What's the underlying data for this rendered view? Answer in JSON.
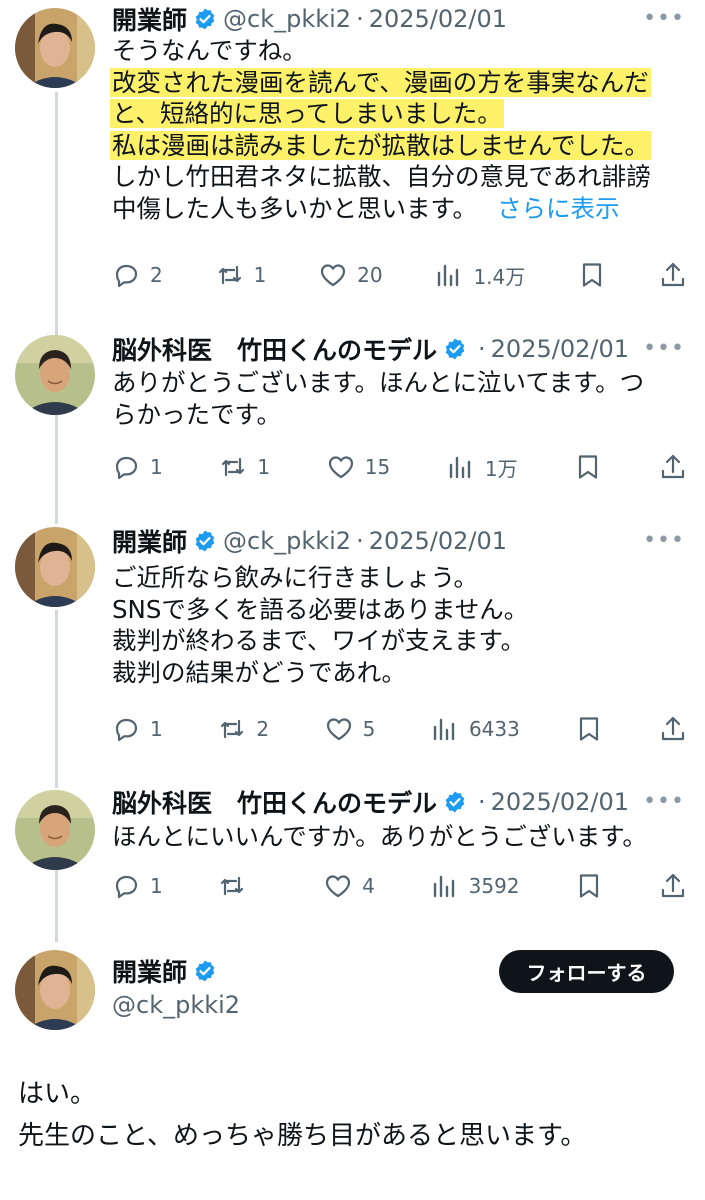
{
  "tweets": [
    {
      "name": "開業師",
      "handle": "@ck_pkki2",
      "date": "2025/02/01",
      "lines": [
        {
          "text": "そうなんですね。",
          "highlight": false
        },
        {
          "text": "改変された漫画を読んで、漫画の方を事実なんだ",
          "highlight": true
        },
        {
          "text": "と、短絡的に思ってしまいました。",
          "highlight": true
        },
        {
          "text": "私は漫画は読みましたが拡散はしませんでした。",
          "highlight": true
        },
        {
          "text": "しかし竹田君ネタに拡散、自分の意見であれ誹謗",
          "highlight": false
        },
        {
          "text": "中傷した人も多いかと思います。",
          "highlight": false
        }
      ],
      "show_more": "さらに表示",
      "replies": "2",
      "retweets": "1",
      "likes": "20",
      "views": "1.4万"
    },
    {
      "name": "脳外科医　竹田くんのモデル",
      "handle": "",
      "date": "2025/02/01",
      "lines": [
        {
          "text": "ありがとうございます。ほんとに泣いてます。つ",
          "highlight": false
        },
        {
          "text": "らかったです。",
          "highlight": false
        }
      ],
      "replies": "1",
      "retweets": "1",
      "likes": "15",
      "views": "1万"
    },
    {
      "name": "開業師",
      "handle": "@ck_pkki2",
      "date": "2025/02/01",
      "lines": [
        {
          "text": "ご近所なら飲みに行きましょう。",
          "highlight": false
        },
        {
          "text": "SNSで多くを語る必要はありません。",
          "highlight": false
        },
        {
          "text": "裁判が終わるまで、ワイが支えます。",
          "highlight": false
        },
        {
          "text": "裁判の結果がどうであれ。",
          "highlight": false
        }
      ],
      "replies": "1",
      "retweets": "2",
      "likes": "5",
      "views": "6433"
    },
    {
      "name": "脳外科医　竹田くんのモデル",
      "handle": "",
      "date": "2025/02/01",
      "lines": [
        {
          "text": "ほんとにいいんですか。ありがとうございます。",
          "highlight": false
        }
      ],
      "replies": "1",
      "retweets": "",
      "likes": "4",
      "views": "3592"
    }
  ],
  "main_tweet": {
    "name": "開業師",
    "handle": "@ck_pkki2",
    "follow_label": "フォローする",
    "lines": [
      "はい。",
      "先生のこと、めっちゃ勝ち目があると思います。"
    ]
  },
  "icons": {
    "verified": "verified-badge-icon",
    "more": "more-icon",
    "reply": "reply-icon",
    "retweet": "retweet-icon",
    "like": "like-icon",
    "views": "views-icon",
    "bookmark": "bookmark-icon",
    "share": "share-icon"
  },
  "colors": {
    "text": "#0f1419",
    "secondary": "#536471",
    "link": "#1d9bf0",
    "verified": "#1d9bf0",
    "highlight": "#fdf16a",
    "thread_line": "#cfd9de",
    "follow_button": "#0f1419"
  }
}
